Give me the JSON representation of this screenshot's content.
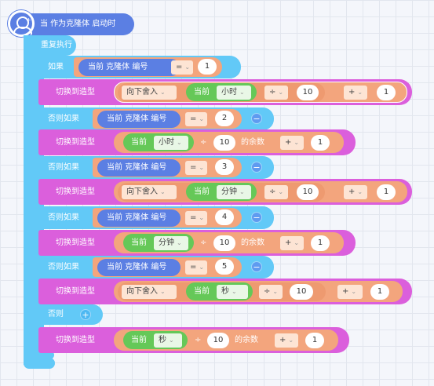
{
  "hat": {
    "label": "当 作为克隆体 启动时"
  },
  "loop": {
    "label": "重复执行"
  },
  "if_label": "如果",
  "elseif_label": "否则如果",
  "else_label": "否则",
  "switch_label": "切换到造型",
  "current": "当前",
  "clone_number": "当前 克隆体 编号",
  "op_eq": "=",
  "op_div": "÷",
  "op_plus": "+",
  "floor_label": "向下舍入",
  "mod_label": "的余数",
  "unit_hour": "小时",
  "unit_minute": "分钟",
  "unit_second": "秒",
  "minus_sign": "−",
  "plus_sign": "+",
  "chevron": "⌄",
  "cond_values": [
    "1",
    "2",
    "3",
    "4",
    "5"
  ],
  "divisor": "10",
  "addend": "1",
  "colors": {
    "event": "#5b7fe3",
    "control": "#62c9f7",
    "looks": "#db5fdc",
    "operator": "#f3a57d",
    "sensing": "#65c858"
  }
}
